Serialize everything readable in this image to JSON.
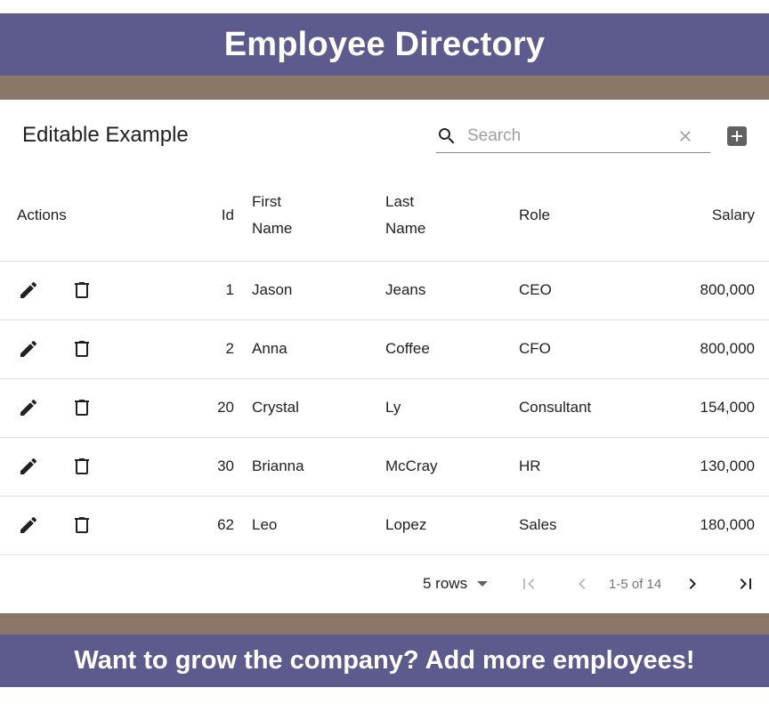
{
  "header": {
    "title": "Employee Directory"
  },
  "table_title": "Editable Example",
  "search": {
    "placeholder": "Search",
    "value": ""
  },
  "icons": {
    "search": "search-icon",
    "clear": "close-icon",
    "add": "add-box-icon",
    "edit": "edit-icon",
    "delete": "delete-icon",
    "rows_dropdown": "arrow-drop-down-icon",
    "first_page": "first-page-icon",
    "prev_page": "chevron-left-icon",
    "next_page": "chevron-right-icon",
    "last_page": "last-page-icon"
  },
  "columns": {
    "actions": "Actions",
    "id": "Id",
    "first_name": "First Name",
    "last_name": "Last Name",
    "role": "Role",
    "salary": "Salary"
  },
  "rows": [
    {
      "id": "1",
      "first_name": "Jason",
      "last_name": "Jeans",
      "role": "CEO",
      "salary": "800,000"
    },
    {
      "id": "2",
      "first_name": "Anna",
      "last_name": "Coffee",
      "role": "CFO",
      "salary": "800,000"
    },
    {
      "id": "20",
      "first_name": "Crystal",
      "last_name": "Ly",
      "role": "Consultant",
      "salary": "154,000"
    },
    {
      "id": "30",
      "first_name": "Brianna",
      "last_name": "McCray",
      "role": "HR",
      "salary": "130,000"
    },
    {
      "id": "62",
      "first_name": "Leo",
      "last_name": "Lopez",
      "role": "Sales",
      "salary": "180,000"
    }
  ],
  "pagination": {
    "rows_per_page": "5 rows",
    "range_text": "1-5 of 14"
  },
  "footer": {
    "text": "Want to grow the company? Add more employees!"
  },
  "colors": {
    "banner": "#5d5b8d",
    "strip": "#8a7767",
    "icon_dark": "#212121",
    "icon_disabled": "#bdbdbd"
  }
}
